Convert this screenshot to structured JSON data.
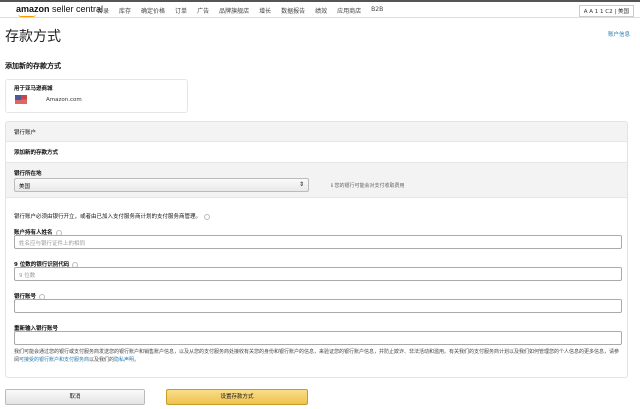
{
  "header": {
    "logo": "amazon seller central",
    "logo_bold": "amazon",
    "logo_rest": " seller central",
    "nav": [
      "目录",
      "库存",
      "确定价格",
      "订单",
      "广告",
      "品牌旗舰店",
      "增长",
      "数据报告",
      "绩效",
      "应用商店",
      "B2B"
    ],
    "account": "A A 1 1 C2 | 美国"
  },
  "page": {
    "title": "存款方式",
    "account_link": "账户信息",
    "section_title": "添加新的存款方式"
  },
  "marketplace": {
    "label": "用于亚马逊商城",
    "value": "Amazon.com"
  },
  "bank": {
    "header": "银行账户",
    "subheader": "添加新的存款方式",
    "location_label": "银行所在地",
    "location_value": "美国",
    "location_hint": "您的银行可能会对支付收取费用",
    "notice": "银行账户必须由银行开立，或者由已加入支付服务商计划的支付服务商管理。",
    "fields": [
      {
        "label": "账户持有人姓名",
        "placeholder": "姓名应与银行证件上的相同",
        "help": true
      },
      {
        "label": "9 位数的银行识别代码",
        "placeholder": "9 位数",
        "help": true
      },
      {
        "label": "银行账号",
        "placeholder": "",
        "help": true
      },
      {
        "label": "重新输入银行账号",
        "placeholder": "",
        "help": false
      }
    ],
    "disclaimer": "我们可能会通过您的银行或支付服务商发送您的银行账户和销售账户信息，以及从您的支付服务商处接收有关您的身份和银行账户的信息，来验证您的银行账户信息，并防止欺诈、非法活动和滥用。有关我们的支付服务商计划以及我们如何管理您的个人信息的更多信息，请参阅",
    "disclaimer_link": "可接受的银行账户和支付服务商",
    "disclaimer_mid": "以及我们的",
    "privacy_link": "隐私声明",
    "disclaimer_end": "。"
  },
  "actions": {
    "cancel": "取消",
    "submit": "设置存款方式"
  }
}
